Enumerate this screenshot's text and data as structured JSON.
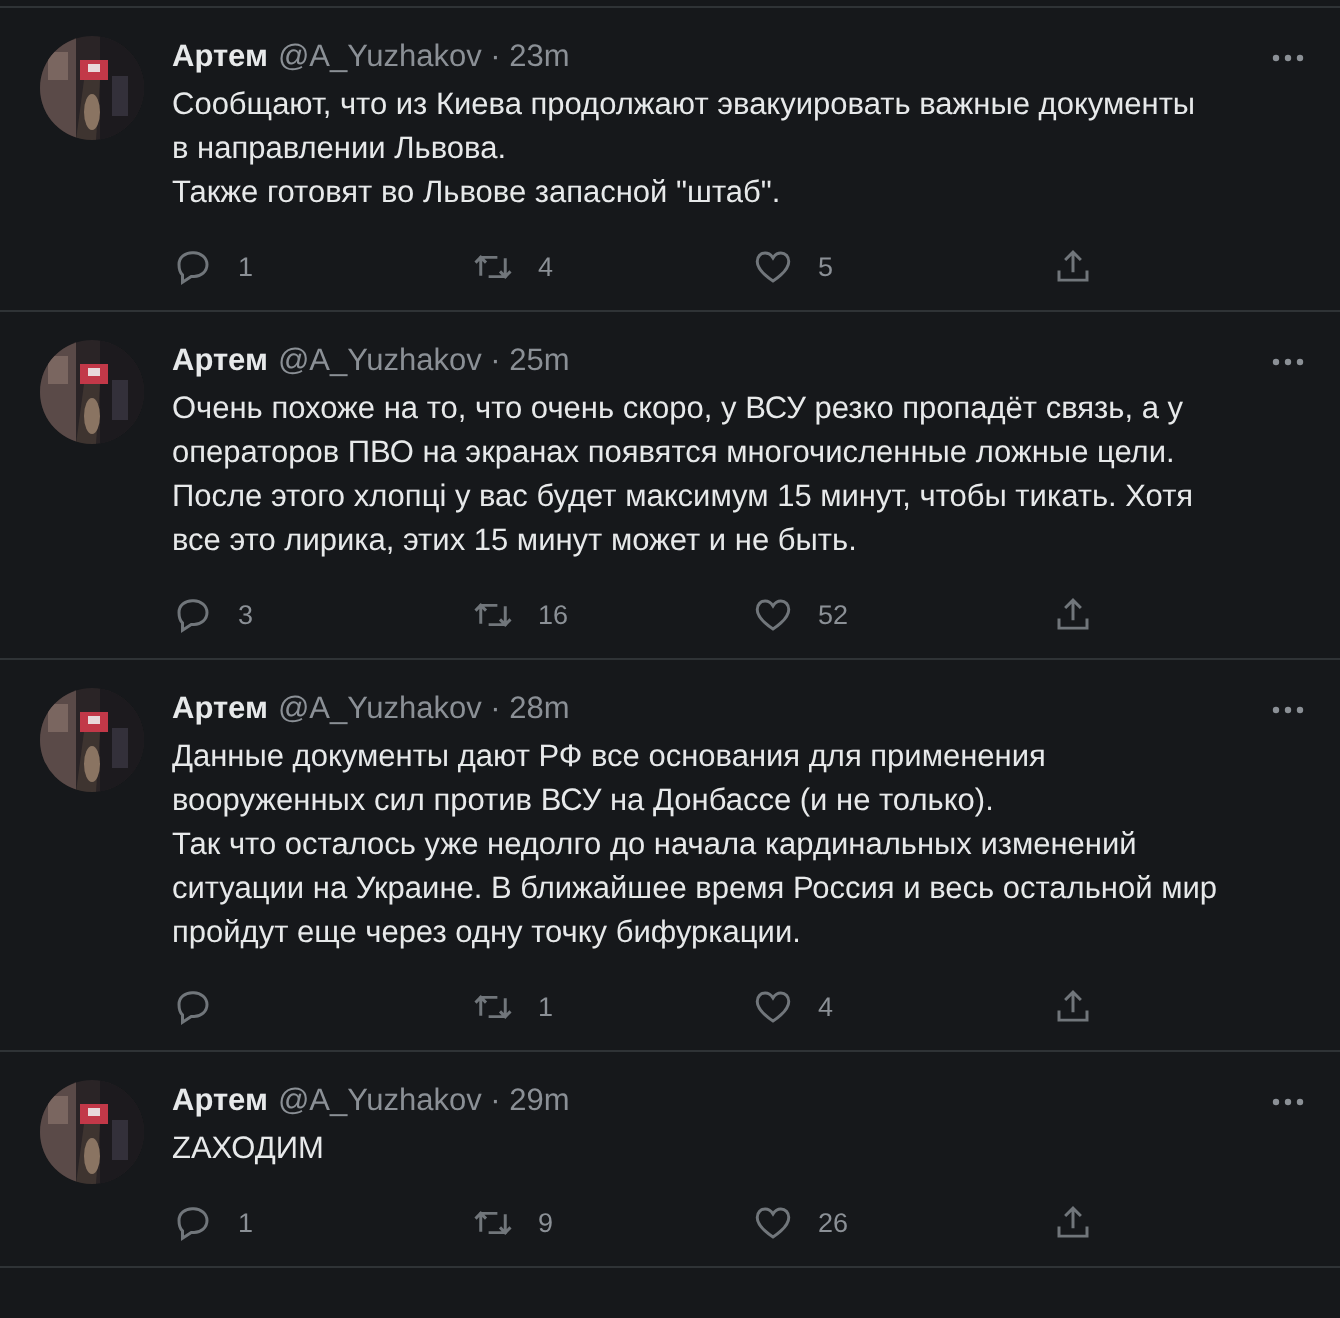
{
  "tweets": [
    {
      "author": "Артем",
      "meta": "@A_Yuzhakov · 23m",
      "lines": [
        "Сообщают, что из Киева продолжают эвакуировать важные документы",
        "в направлении Львова.",
        "Также готовят во Львове запасной \"штаб\"."
      ],
      "replies": "1",
      "retweets": "4",
      "likes": "5"
    },
    {
      "author": "Артем",
      "meta": "@A_Yuzhakov · 25m",
      "lines": [
        "Очень похоже на то, что очень скоро, у ВСУ резко пропадёт связь, а у",
        "операторов ПВО на экранах появятся многочисленные ложные цели.",
        "После этого хлопці у вас будет максимум 15 минут, чтобы тикать. Хотя",
        "все это лирика, этих 15 минут может и не быть."
      ],
      "replies": "3",
      "retweets": "16",
      "likes": "52"
    },
    {
      "author": "Артем",
      "meta": "@A_Yuzhakov · 28m",
      "lines": [
        "Данные документы дают РФ все основания для применения",
        "вооруженных сил против ВСУ на Донбассе (и не только).",
        "Так что осталось уже недолго до начала кардинальных изменений",
        "ситуации на Украине. В ближайшее время Россия и весь остальной мир",
        "пройдут еще через одну точку бифуркации."
      ],
      "retweets": "1",
      "likes": "4"
    },
    {
      "author": "Артем",
      "meta": "@A_Yuzhakov · 29m",
      "lines": [
        "ZАХОДИМ"
      ],
      "replies": "1",
      "retweets": "9",
      "likes": "26"
    }
  ]
}
